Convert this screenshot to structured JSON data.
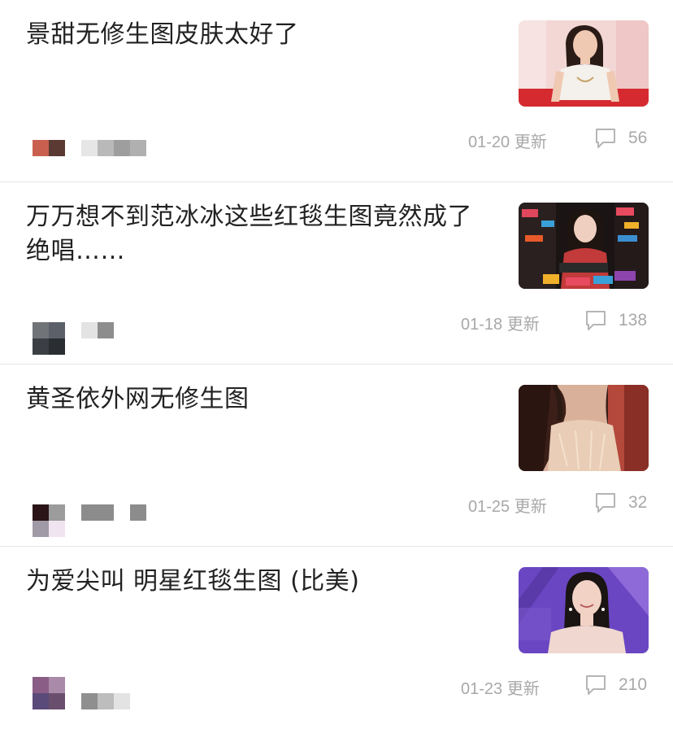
{
  "feed": {
    "items": [
      {
        "title": "景甜无修生图皮肤太好了",
        "date": "01-20 更新",
        "comments": "56",
        "thumb_colors": {
          "bg": "#f2d7d5",
          "accent": "#d42a30",
          "skin": "#f0c9b3",
          "hair": "#2a1b17",
          "top": "#f4f1ec"
        },
        "avatar_colors": [
          "#c9604f",
          "#5a3a33",
          "#ffffff",
          "#ffffff"
        ],
        "name_colors": [
          "#e6e6e6",
          "#b9b9b9",
          "#9e9e9e",
          "#b0b0b0"
        ]
      },
      {
        "title": "万万想不到范冰冰这些红毯生图竟然成了绝唱……",
        "date": "01-18 更新",
        "comments": "138",
        "thumb_colors": {
          "bg": "#1a1414",
          "accent": "#e0475c",
          "skin": "#efcfbf",
          "hair": "#1e1410",
          "top": "#c23a3a"
        },
        "avatar_colors": [
          "#707378",
          "#5b6069",
          "#3b3e43",
          "#2a2d31"
        ],
        "name_colors": [
          "#e3e3e3",
          "#8d8d8d"
        ]
      },
      {
        "title": "黄圣依外网无修生图",
        "date": "01-25 更新",
        "comments": "32",
        "thumb_colors": {
          "bg": "#3b1f18",
          "accent": "#b3483b",
          "skin": "#d9b09a",
          "hair": "#2b1a14",
          "top": "#e9cdb6"
        },
        "avatar_colors": [
          "#2b1418",
          "#9c9c9c",
          "#a09aa6",
          "#efe4ef"
        ],
        "name_colors": [
          "#8c8c8c",
          "#8c8c8c",
          "#8c8c8c"
        ]
      },
      {
        "title": "为爱尖叫 明星红毯生图 (比美)",
        "date": "01-23 更新",
        "comments": "210",
        "thumb_colors": {
          "bg": "#6a46c2",
          "accent": "#8e6ad8",
          "skin": "#f1d2c4",
          "hair": "#1a1412",
          "top": "#f0d8d0"
        },
        "avatar_colors": [
          "#8a5d87",
          "#a98aa8",
          "#5a4a7a",
          "#6a4e6e"
        ],
        "name_colors": [
          "#8f8f8f",
          "#bdbdbd",
          "#e3e3e3"
        ]
      }
    ]
  }
}
